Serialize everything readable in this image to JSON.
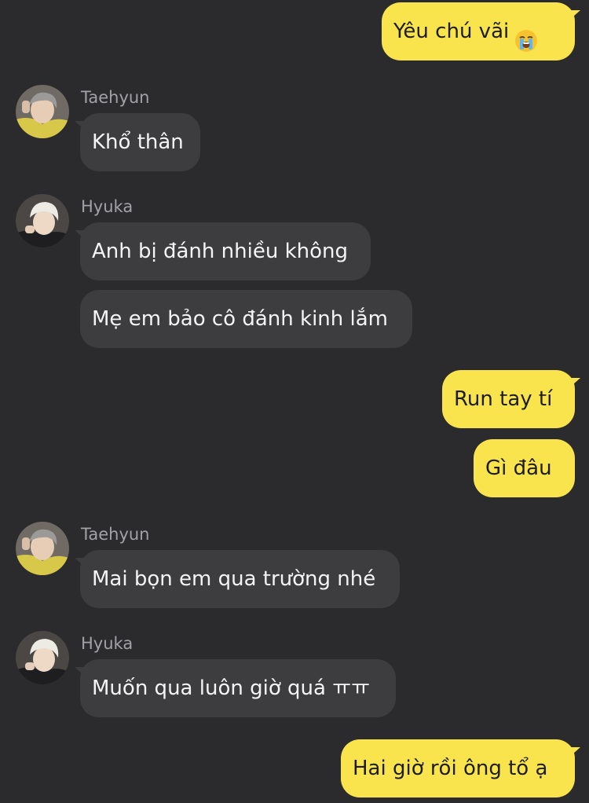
{
  "messages": [
    {
      "from": "me",
      "text": "Yêu chú vãi",
      "emoji": "loudly-crying-face"
    },
    {
      "from": "other",
      "sender": "Taehyun",
      "text": "Khổ thân"
    },
    {
      "from": "other",
      "sender": "Hyuka",
      "text": "Anh bị đánh nhiều không"
    },
    {
      "from": "other",
      "text": "Mẹ em bảo cô đánh kinh lắm"
    },
    {
      "from": "me",
      "text": "Run tay tí"
    },
    {
      "from": "me",
      "text": "Gì đâu"
    },
    {
      "from": "other",
      "sender": "Taehyun",
      "text": "Mai bọn em qua trường nhé"
    },
    {
      "from": "other",
      "sender": "Hyuka",
      "text": "Muốn qua luôn giờ quá ㅠㅠ"
    },
    {
      "from": "me",
      "text": "Hai giờ rồi ông tổ ạ"
    }
  ],
  "colors": {
    "background": "#2b2b2d",
    "my_bubble": "#f9e44e",
    "their_bubble": "#3d3d40",
    "sender_name": "#a2a2a6"
  }
}
